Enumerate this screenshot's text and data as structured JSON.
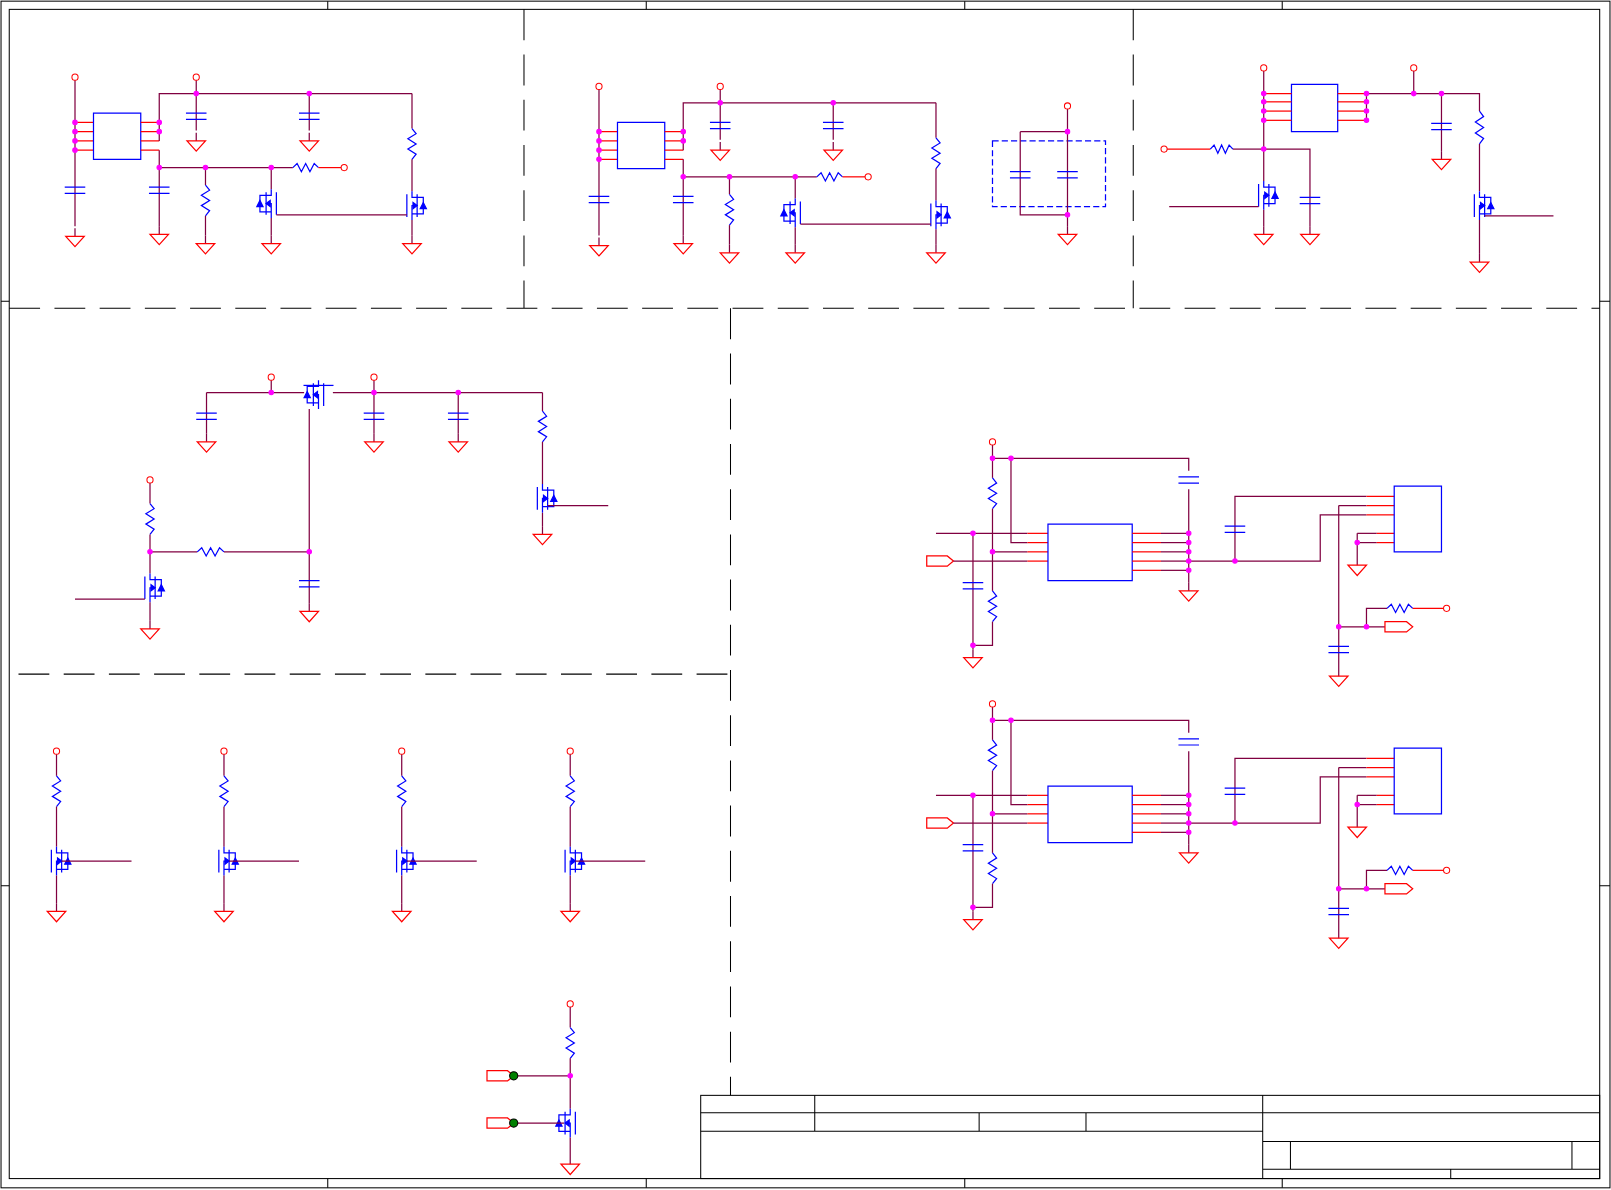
{
  "sheet": {
    "circuits": [
      {
        "kind": "regulator"
      },
      {
        "kind": "regulator"
      },
      {
        "kind": "capacitor-bank"
      },
      {
        "kind": "charger"
      },
      {
        "kind": "power-switch"
      },
      {
        "kind": "interface"
      },
      {
        "kind": "interface"
      },
      {
        "kind": "led-driver"
      },
      {
        "kind": "led-driver"
      },
      {
        "kind": "led-driver"
      },
      {
        "kind": "led-driver"
      },
      {
        "kind": "level-shifter"
      }
    ],
    "title_block": true
  }
}
